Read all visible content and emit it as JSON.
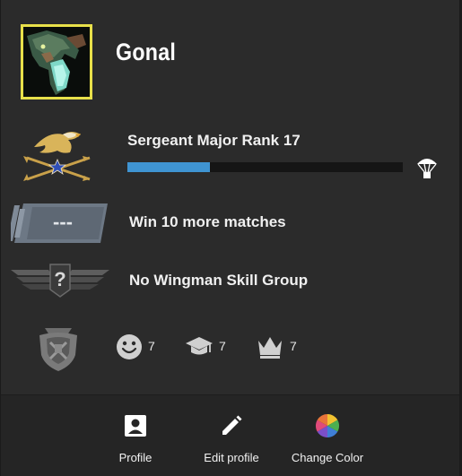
{
  "profile": {
    "username": "Gonal",
    "avatar_icon": "dragon-avatar",
    "avatar_border_color": "#e8e04a"
  },
  "rank": {
    "title": "Sergeant Major Rank 17",
    "icon": "eagle-rank-emblem",
    "progress_fraction": 0.3,
    "progress_color": "#3f94d2",
    "drop_icon": "parachute-icon"
  },
  "competitive": {
    "icon": "competitive-rank-placeholder",
    "placeholder": "---",
    "text": "Win 10 more matches"
  },
  "wingman": {
    "icon": "wingman-unranked-emblem",
    "symbol": "?",
    "text": "No Wingman Skill Group"
  },
  "commendations": {
    "service_medal_icon": "service-medal-icon",
    "friendly": {
      "icon": "smile-icon",
      "value": "7"
    },
    "teacher": {
      "icon": "graduation-cap-icon",
      "value": "7"
    },
    "leader": {
      "icon": "crown-icon",
      "value": "7"
    }
  },
  "actions": [
    {
      "icon": "profile-icon",
      "label": "Profile"
    },
    {
      "icon": "pencil-icon",
      "label": "Edit profile"
    },
    {
      "icon": "color-wheel-icon",
      "label": "Change Color"
    }
  ]
}
